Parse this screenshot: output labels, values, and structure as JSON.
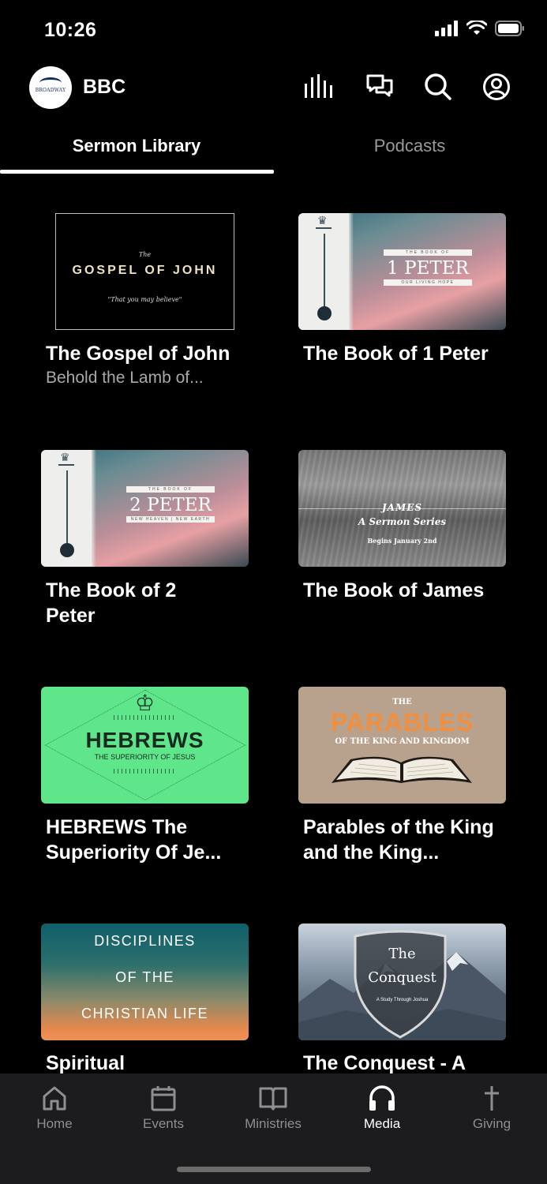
{
  "status_bar": {
    "time": "10:26"
  },
  "header": {
    "title": "BBC",
    "logo_text": "BROADWAY"
  },
  "tabs": [
    {
      "label": "Sermon Library",
      "active": true
    },
    {
      "label": "Podcasts",
      "active": false
    }
  ],
  "sermons": [
    {
      "title": "The Gospel of John",
      "subtitle": "Behold the Lamb of...",
      "thumb": {
        "small": "The",
        "big": "GOSPEL OF JOHN",
        "tag": "\"That you may believe\""
      }
    },
    {
      "title": "The Book of 1 Peter",
      "subtitle": "",
      "thumb": {
        "top": "THE BOOK OF",
        "main": "1 PETER",
        "bottom": "OUR LIVING HOPE"
      }
    },
    {
      "title": "The Book of 2 Peter",
      "subtitle": "",
      "thumb": {
        "top": "THE BOOK OF",
        "main": "2 PETER",
        "bottom": "NEW HEAVEN | NEW EARTH"
      }
    },
    {
      "title": "The Book of James",
      "subtitle": "",
      "thumb": {
        "title": "JAMES",
        "sub": "A Sermon Series",
        "begins": "Begins January 2nd"
      }
    },
    {
      "title": "HEBREWS The Superiority Of Je...",
      "subtitle": "",
      "thumb": {
        "title": "HEBREWS",
        "sub": "THE SUPERIORITY OF JESUS"
      }
    },
    {
      "title": "Parables of the King and the King...",
      "subtitle": "",
      "thumb": {
        "the": "THE",
        "big": "PARABLES",
        "sub": "OF THE KING AND KINGDOM"
      }
    },
    {
      "title": "Spiritual",
      "subtitle": "",
      "thumb": {
        "line1": "DISCIPLINES",
        "line2": "OF THE",
        "line3": "CHRISTIAN LIFE"
      }
    },
    {
      "title": "The Conquest - A",
      "subtitle": "",
      "thumb": {
        "line1": "The",
        "line2": "Conquest",
        "line3": "A Study Through Joshua"
      }
    }
  ],
  "bottom_nav": [
    {
      "label": "Home",
      "icon": "home-icon",
      "active": false
    },
    {
      "label": "Events",
      "icon": "calendar-icon",
      "active": false
    },
    {
      "label": "Ministries",
      "icon": "book-icon",
      "active": false
    },
    {
      "label": "Media",
      "icon": "headphones-icon",
      "active": true
    },
    {
      "label": "Giving",
      "icon": "cross-icon",
      "active": false
    }
  ]
}
